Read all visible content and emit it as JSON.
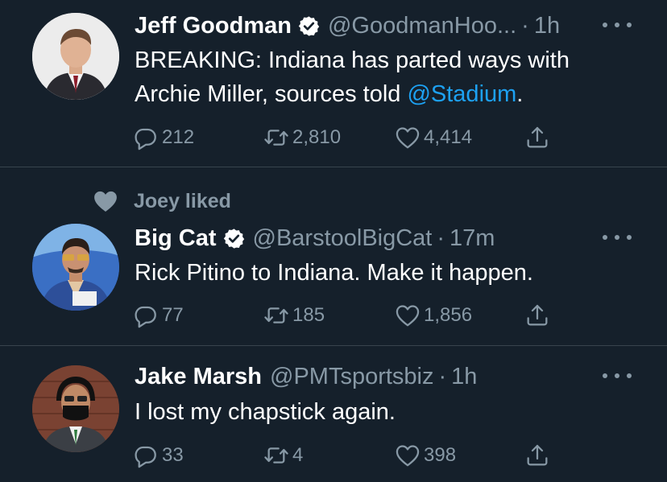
{
  "colors": {
    "background": "#15202b",
    "text_primary": "#ffffff",
    "text_secondary": "#8899a6",
    "link": "#1da1f2",
    "verified_badge": "#ffffff",
    "divider": "#38444d"
  },
  "tweets": [
    {
      "name": "Jeff Goodman",
      "verified": true,
      "handle": "@GoodmanHoo...",
      "separator": "·",
      "time": "1h",
      "text_before": "BREAKING: Indiana has parted ways with Archie Miller, sources told ",
      "mention": "@Stadium",
      "text_after": ".",
      "replies": "212",
      "retweets": "2,810",
      "likes": "4,414",
      "icons": {
        "reply": "reply-icon",
        "retweet": "retweet-icon",
        "like": "heart-icon",
        "share": "share-icon",
        "more": "more-icon"
      }
    },
    {
      "social_context": "Joey liked",
      "name": "Big Cat",
      "verified": true,
      "handle": "@BarstoolBigCat",
      "separator": "·",
      "time": "17m",
      "text": "Rick Pitino to Indiana. Make it happen.",
      "replies": "77",
      "retweets": "185",
      "likes": "1,856",
      "icons": {
        "reply": "reply-icon",
        "retweet": "retweet-icon",
        "like": "heart-icon",
        "share": "share-icon",
        "more": "more-icon"
      }
    },
    {
      "name": "Jake Marsh",
      "verified": false,
      "handle": "@PMTsportsbiz",
      "separator": "·",
      "time": "1h",
      "text": "I lost my chapstick again.",
      "replies": "33",
      "retweets": "4",
      "likes": "398",
      "icons": {
        "reply": "reply-icon",
        "retweet": "retweet-icon",
        "like": "heart-icon",
        "share": "share-icon",
        "more": "more-icon"
      }
    }
  ]
}
